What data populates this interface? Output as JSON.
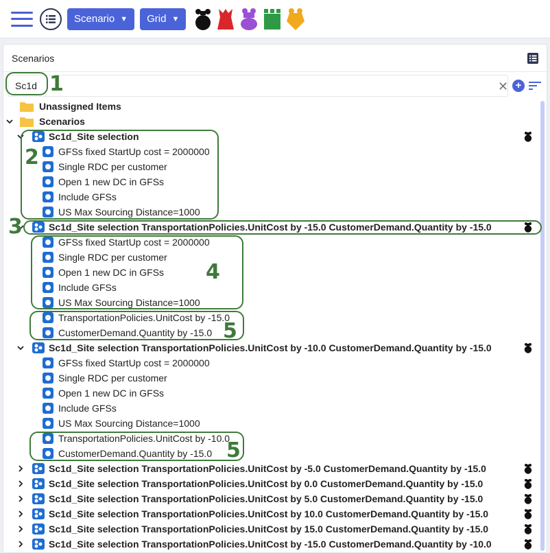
{
  "toolbar": {
    "scenario_label": "Scenario",
    "grid_label": "Grid"
  },
  "panel": {
    "title": "Scenarios"
  },
  "search": {
    "value": "Sc1d"
  },
  "tree": {
    "unassigned": "Unassigned Items",
    "scenarios": "Scenarios",
    "s1": {
      "name": "Sc1d_Site selection",
      "children": [
        "GFSs fixed StartUp cost = 2000000",
        "Single RDC per customer",
        "Open 1 new DC in GFSs",
        "Include GFSs",
        "US Max Sourcing Distance=1000"
      ]
    },
    "s2": {
      "name": "Sc1d_Site selection TransportationPolicies.UnitCost by -15.0 CustomerDemand.Quantity by -15.0",
      "children": [
        "GFSs fixed StartUp cost = 2000000",
        "Single RDC per customer",
        "Open 1 new DC in GFSs",
        "Include GFSs",
        "US Max Sourcing Distance=1000",
        "TransportationPolicies.UnitCost by -15.0",
        "CustomerDemand.Quantity by -15.0"
      ]
    },
    "s3": {
      "name": "Sc1d_Site selection TransportationPolicies.UnitCost by -10.0 CustomerDemand.Quantity by -15.0",
      "children": [
        "GFSs fixed StartUp cost = 2000000",
        "Single RDC per customer",
        "Open 1 new DC in GFSs",
        "Include GFSs",
        "US Max Sourcing Distance=1000",
        "TransportationPolicies.UnitCost by -10.0",
        "CustomerDemand.Quantity by -15.0"
      ]
    },
    "collapsed": [
      "Sc1d_Site selection TransportationPolicies.UnitCost by -5.0 CustomerDemand.Quantity by -15.0",
      "Sc1d_Site selection TransportationPolicies.UnitCost by 0.0 CustomerDemand.Quantity by -15.0",
      "Sc1d_Site selection TransportationPolicies.UnitCost by 5.0 CustomerDemand.Quantity by -15.0",
      "Sc1d_Site selection TransportationPolicies.UnitCost by 10.0 CustomerDemand.Quantity by -15.0",
      "Sc1d_Site selection TransportationPolicies.UnitCost by 15.0 CustomerDemand.Quantity by -15.0",
      "Sc1d_Site selection TransportationPolicies.UnitCost by -15.0 CustomerDemand.Quantity by -10.0"
    ]
  },
  "annotations": [
    "1",
    "2",
    "3",
    "4",
    "5",
    "5"
  ],
  "colors": {
    "accent": "#4b63d8",
    "scenario_icon": "#1e6dd1",
    "annotation": "#3f7a3a",
    "folder": "#f6c343"
  },
  "icons": [
    "menu-icon",
    "list-icon",
    "bomb-icon",
    "red-piece-icon",
    "purple-piece-icon",
    "green-tower-icon",
    "yellow-piece-icon",
    "folder-icon",
    "scenario-icon",
    "scenario-group-icon",
    "close-icon",
    "add-icon",
    "sort-icon"
  ]
}
